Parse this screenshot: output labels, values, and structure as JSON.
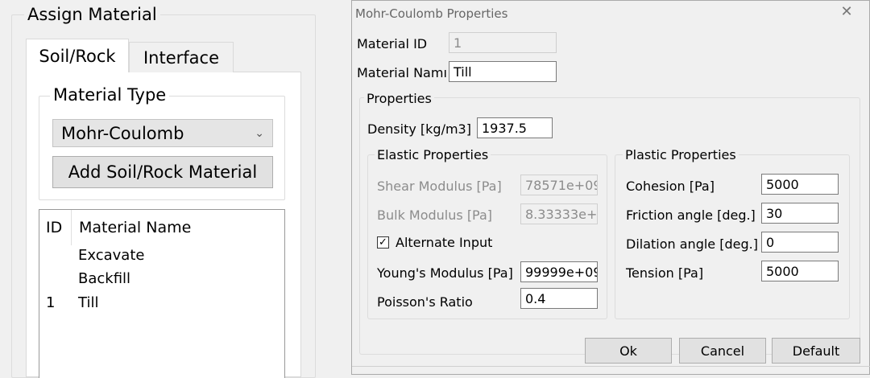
{
  "assign_panel": {
    "title": "Assign Material",
    "tabs": [
      "Soil/Rock",
      "Interface"
    ],
    "material_type_title": "Material Type",
    "material_type_value": "Mohr-Coulomb",
    "add_button": "Add Soil/Rock Material",
    "list": {
      "headers": [
        "ID",
        "Material Name"
      ],
      "rows": [
        {
          "id": "",
          "name": "Excavate"
        },
        {
          "id": "",
          "name": "Backfill"
        },
        {
          "id": "1",
          "name": "Till"
        }
      ]
    }
  },
  "dialog": {
    "title": "Mohr-Coulomb Properties",
    "close_icon": "✕",
    "material_id_label": "Material ID",
    "material_id_value": "1",
    "material_name_label": "Material Namı",
    "material_name_value": "Till",
    "properties_title": "Properties",
    "density_label": "Density [kg/m3]",
    "density_value": "1937.5",
    "elastic": {
      "title": "Elastic Properties",
      "shear_label": "Shear Modulus [Pa]",
      "shear_value": "78571e+09",
      "bulk_label": "Bulk Modulus [Pa]",
      "bulk_value": "8.33333e+(",
      "alternate_label": "Alternate Input",
      "alternate_checked": true,
      "youngs_label": "Young's Modulus [Pa]",
      "youngs_value": "99999e+09",
      "poisson_label": "Poisson's Ratio",
      "poisson_value": "0.4"
    },
    "plastic": {
      "title": "Plastic Properties",
      "cohesion_label": "Cohesion [Pa]",
      "cohesion_value": "5000",
      "friction_label": "Friction angle [deg.]",
      "friction_value": "30",
      "dilation_label": "Dilation angle [deg.]",
      "dilation_value": "0",
      "tension_label": "Tension [Pa]",
      "tension_value": "5000"
    },
    "buttons": {
      "ok": "Ok",
      "cancel": "Cancel",
      "default": "Default"
    }
  }
}
